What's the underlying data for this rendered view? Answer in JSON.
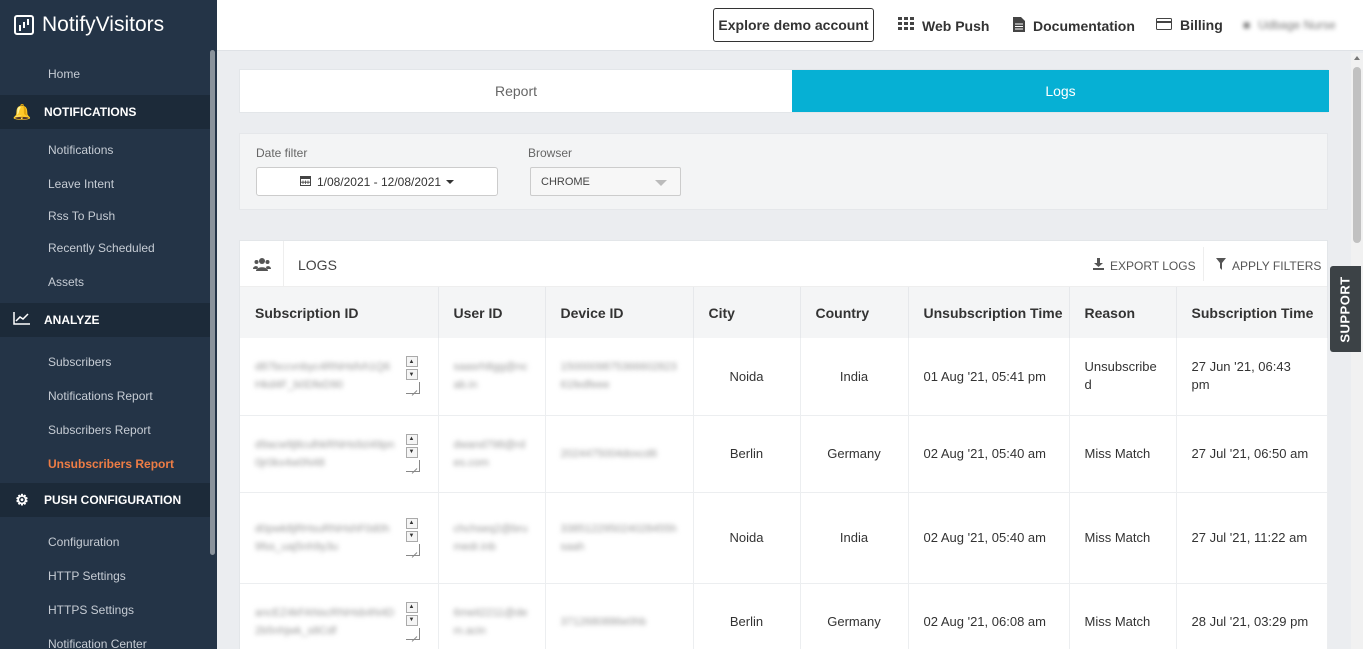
{
  "app": {
    "name": "NotifyVisitors"
  },
  "sidebar": {
    "home": "Home",
    "sections": [
      {
        "title": "NOTIFICATIONS",
        "icon": "bell-icon",
        "items": [
          "Notifications",
          "Leave Intent",
          "Rss To Push",
          "Recently Scheduled",
          "Assets"
        ]
      },
      {
        "title": "ANALYZE",
        "icon": "chart-icon",
        "items": [
          "Subscribers",
          "Notifications Report",
          "Subscribers Report",
          "Unsubscribers Report"
        ]
      },
      {
        "title": "PUSH CONFIGURATION",
        "icon": "gear-icon",
        "items": [
          "Configuration",
          "HTTP Settings",
          "HTTPS Settings",
          "Notification Center"
        ]
      }
    ],
    "active_item": "Unsubscribers Report",
    "active_color": "#ee7d45"
  },
  "topbar": {
    "demo_button": "Explore demo account",
    "web_push": "Web Push",
    "documentation": "Documentation",
    "billing": "Billing",
    "user": "Udbage Nurse"
  },
  "tabs": {
    "report": "Report",
    "logs": "Logs",
    "active": "Logs",
    "active_color": "#06b0d4"
  },
  "filters": {
    "date_label": "Date filter",
    "date_value": "1/08/2021 - 12/08/2021",
    "browser_label": "Browser",
    "browser_value": "CHROME"
  },
  "logs": {
    "title": "LOGS",
    "export": "EXPORT LOGS",
    "apply": "APPLY FILTERS",
    "columns": [
      "Subscription ID",
      "User ID",
      "Device ID",
      "City",
      "Country",
      "Unsubscription Time",
      "Reason",
      "Subscription Time"
    ],
    "rows": [
      {
        "sub_id": "d87bccvnbyc4RNHsfvh1Q6Hkd4F_b0DfeD90",
        "user_id": "saasrh8gg@ncab.in",
        "device_id": "150000987536660282361fedfeee",
        "city": "Noida",
        "country": "India",
        "unsub_time": "01 Aug '21, 05:41 pm",
        "reason": "Unsubscribed",
        "sub_time": "27 Jun '21, 06:43 pm"
      },
      {
        "sub_id": "d9acw9jtlculhkRNHs9zi49pn0jr0kx4w0N48",
        "user_id": "dwand798@rdes.com",
        "device_id": "2024475004doxcd6",
        "city": "Berlin",
        "country": "Germany",
        "unsub_time": "02 Aug '21, 05:40 am",
        "reason": "Miss Match",
        "sub_time": "27 Jul '21, 06:50 am"
      },
      {
        "sub_id": "d0pwk8jRHsuRNHshF0d0h9fss_uaj5nh9y3u",
        "user_id": "chchseq2@brumedr.inb",
        "device_id": "338512295024028455hsaah",
        "city": "Noida",
        "country": "India",
        "unsub_time": "02 Aug '21, 05:40 am",
        "reason": "Miss Match",
        "sub_time": "27 Jul '21, 11:22 am"
      },
      {
        "sub_id": "ancEZ4kFANscRNHsb4N4D2b5nhjwk_s8Cdf",
        "user_id": "6meit2211@dem.acin",
        "device_id": "3712680886e0hb",
        "city": "Berlin",
        "country": "Germany",
        "unsub_time": "02 Aug '21, 06:08 am",
        "reason": "Miss Match",
        "sub_time": "28 Jul '21, 03:29 pm"
      }
    ]
  },
  "support": "SUPPORT"
}
